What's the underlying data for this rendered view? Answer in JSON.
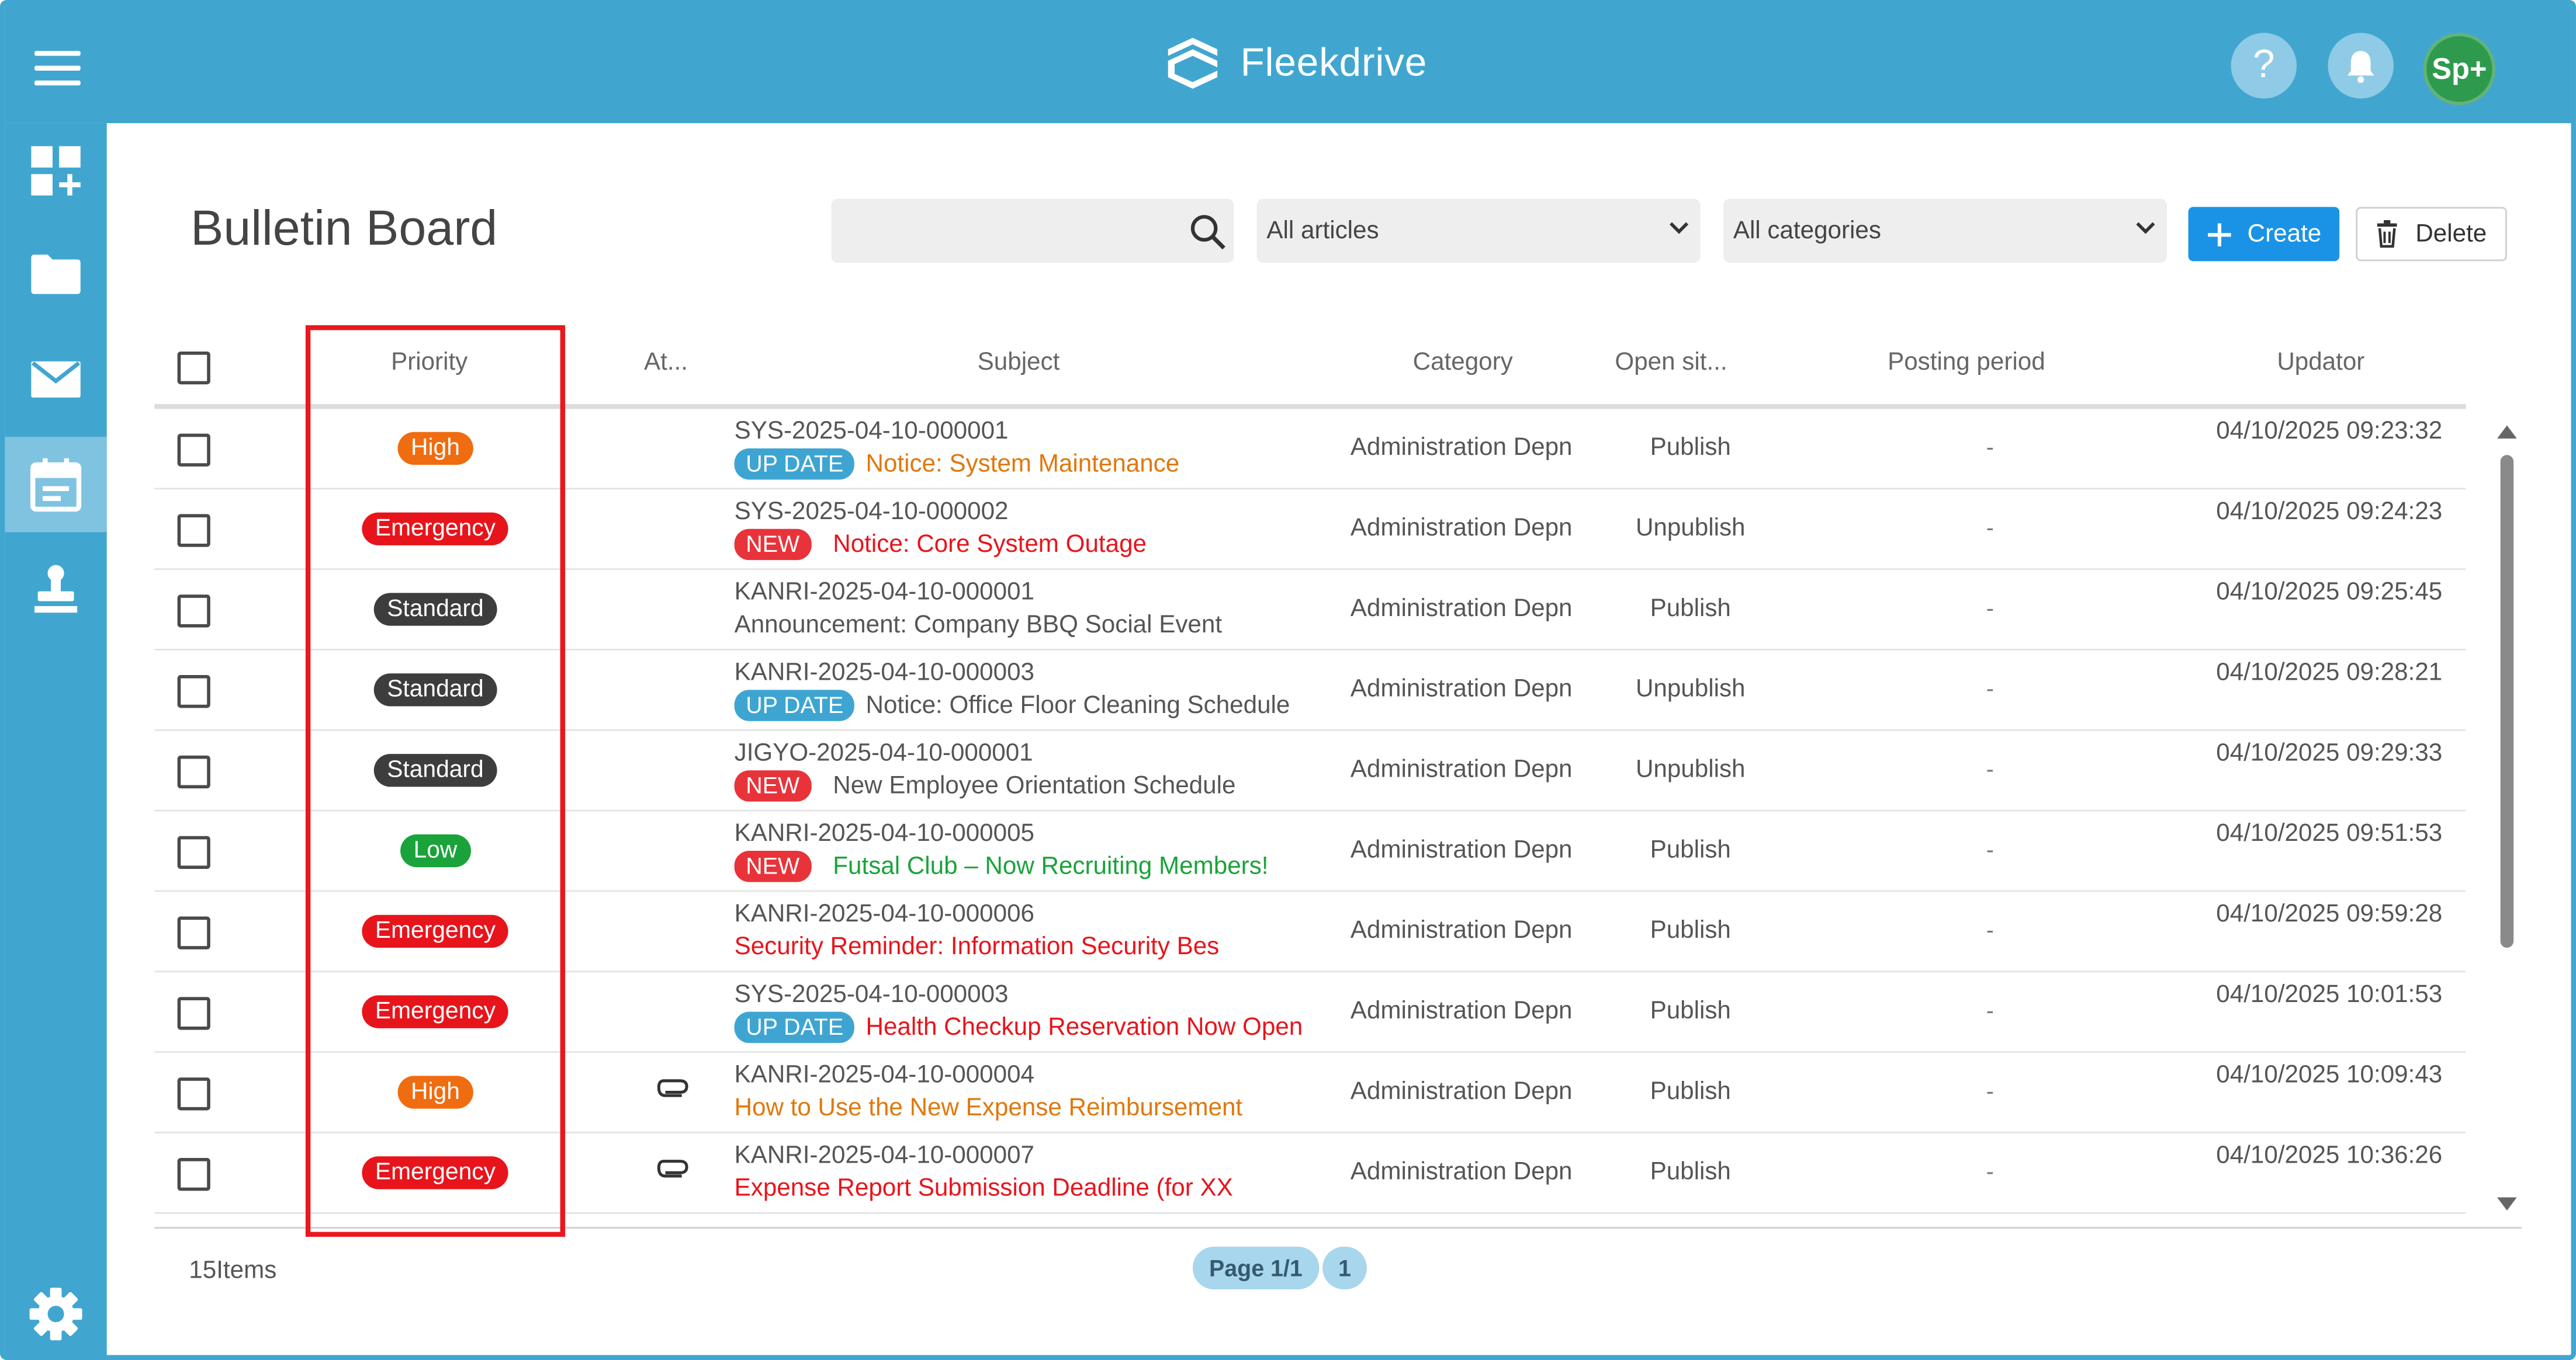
{
  "app": {
    "logo_text": "Fleekdrive",
    "avatar_text": "Sp+",
    "help_glyph": "?"
  },
  "colors": {
    "header": "#41a6cf",
    "create": "#1a93e6",
    "high": "#f06c10",
    "emergency": "#e8141b",
    "standard": "#3d3d3d",
    "low": "#1aa33a",
    "tag_new": "#e8333a",
    "tag_update": "#3ea5d2"
  },
  "page": {
    "title": "Bulletin Board"
  },
  "filters": {
    "search_placeholder": "",
    "articles": "All articles",
    "categories": "All categories"
  },
  "actions": {
    "create": "Create",
    "delete": "Delete"
  },
  "columns": {
    "priority": "Priority",
    "attachment": "At...",
    "subject": "Subject",
    "category": "Category",
    "open": "Open sit...",
    "period": "Posting period",
    "updator": "Updator"
  },
  "rows": [
    {
      "priority": "High",
      "code": "SYS-2025-04-10-000001",
      "tag": "UP DATE",
      "subject": "Notice: System Maintenance",
      "category": "Administration Depn",
      "open": "Publish",
      "period": "-",
      "updated": "04/10/2025 09:23:32"
    },
    {
      "priority": "Emergency",
      "code": "SYS-2025-04-10-000002",
      "tag": "NEW",
      "subject": "Notice: Core System Outage",
      "category": "Administration Depn",
      "open": "Unpublish",
      "period": "-",
      "updated": "04/10/2025 09:24:23"
    },
    {
      "priority": "Standard",
      "code": "KANRI-2025-04-10-000001",
      "tag": "",
      "subject": "Announcement: Company BBQ Social Event",
      "category": "Administration Depn",
      "open": "Publish",
      "period": "-",
      "updated": "04/10/2025 09:25:45"
    },
    {
      "priority": "Standard",
      "code": "KANRI-2025-04-10-000003",
      "tag": "UP DATE",
      "subject": "Notice: Office Floor Cleaning Schedule",
      "category": "Administration Depn",
      "open": "Unpublish",
      "period": "-",
      "updated": "04/10/2025 09:28:21"
    },
    {
      "priority": "Standard",
      "code": "JIGYO-2025-04-10-000001",
      "tag": "NEW",
      "subject": "New Employee Orientation Schedule",
      "category": "Administration Depn",
      "open": "Unpublish",
      "period": "-",
      "updated": "04/10/2025 09:29:33"
    },
    {
      "priority": "Low",
      "code": "KANRI-2025-04-10-000005",
      "tag": "NEW",
      "subject": "Futsal Club – Now Recruiting Members!",
      "category": "Administration Depn",
      "open": "Publish",
      "period": "-",
      "updated": "04/10/2025 09:51:53"
    },
    {
      "priority": "Emergency",
      "code": "KANRI-2025-04-10-000006",
      "tag": "",
      "subject": "Security Reminder: Information Security Bes",
      "category": "Administration Depn",
      "open": "Publish",
      "period": "-",
      "updated": "04/10/2025 09:59:28"
    },
    {
      "priority": "Emergency",
      "code": "SYS-2025-04-10-000003",
      "tag": "UP DATE",
      "subject": "Health Checkup Reservation Now Open",
      "category": "Administration Depn",
      "open": "Publish",
      "period": "-",
      "updated": "04/10/2025 10:01:53"
    },
    {
      "priority": "High",
      "code": "KANRI-2025-04-10-000004",
      "tag": "",
      "subject": "How to Use the New Expense Reimbursement",
      "category": "Administration Depn",
      "open": "Publish",
      "period": "-",
      "updated": "04/10/2025 10:09:43"
    },
    {
      "priority": "Emergency",
      "code": "KANRI-2025-04-10-000007",
      "tag": "",
      "subject": "Expense Report Submission Deadline (for XX",
      "category": "Administration Depn",
      "open": "Publish",
      "period": "-",
      "updated": "04/10/2025 10:36:26"
    }
  ],
  "footer": {
    "count": "15Items",
    "page_label": "Page 1/1",
    "page_num": "1"
  }
}
